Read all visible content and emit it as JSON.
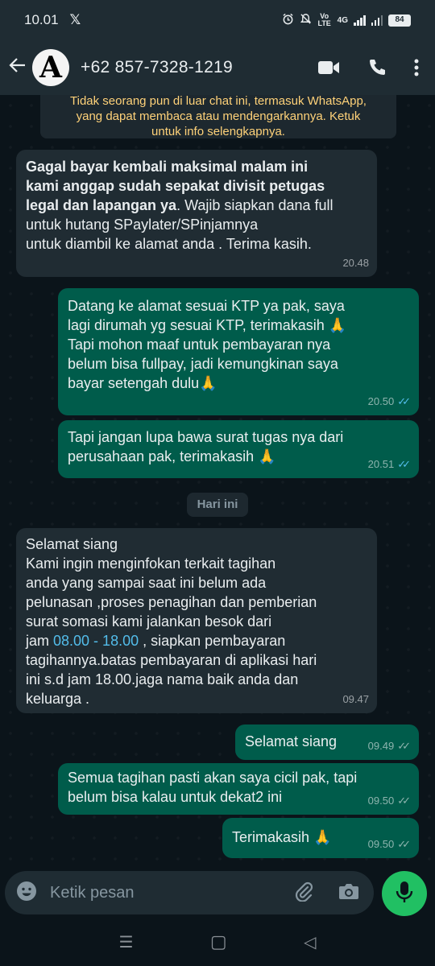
{
  "status_bar": {
    "time": "10.01",
    "x_logo": "𝕏",
    "network": "Vo LTE",
    "signal_label": "4G",
    "battery": "84"
  },
  "header": {
    "back_icon": "arrow-left-icon",
    "avatar_letter": "A",
    "contact": "+62 857-7328-1219",
    "icons": [
      "video-call-icon",
      "voice-call-icon",
      "more-vert-icon"
    ]
  },
  "encryption_notice": {
    "line1": "Tidak seorang pun di luar chat ini, termasuk WhatsApp,",
    "line2": "yang dapat membaca atau mendengarkannya. Ketuk",
    "line3": "untuk info selengkapnya."
  },
  "messages": [
    {
      "direction": "in",
      "bold_lines": [
        "Gagal bayar kembali maksimal malam ini",
        "kami anggap sudah sepakat divisit petugas",
        "legal dan lapangan ya"
      ],
      "rest_first": ". Wajib siapkan dana full",
      "lines": [
        "untuk hutang SPaylater/SPinjamnya",
        "untuk diambil ke alamat anda . Terima kasih."
      ],
      "time": "20.48"
    },
    {
      "direction": "out",
      "lines": [
        "Datang ke alamat sesuai KTP ya pak, saya",
        "lagi dirumah yg sesuai KTP, terimakasih 🙏",
        "Tapi mohon maaf untuk pembayaran nya",
        "belum bisa fullpay, jadi kemungkinan saya",
        "bayar setengah dulu🙏"
      ],
      "time": "20.50",
      "ticks": "✓✓"
    },
    {
      "direction": "out",
      "lines": [
        "Tapi jangan lupa bawa surat tugas nya dari",
        "perusahaan pak, terimakasih 🙏"
      ],
      "time": "20.51",
      "ticks": "✓✓"
    },
    {
      "direction": "in",
      "lines": [
        "Selamat siang",
        "Kami ingin menginfokan terkait tagihan",
        "anda yang sampai saat ini belum ada",
        "pelunasan ,proses penagihan dan pemberian",
        "surat somasi kami jalankan besok dari"
      ],
      "line6_prefix": "jam ",
      "line6_link": "08.00 - 18.00",
      "line6_suffix": " , siapkan pembayaran",
      "lines_after": [
        "tagihannya.batas pembayaran di aplikasi hari",
        "ini s.d jam 18.00.jaga nama baik anda dan",
        "keluarga ."
      ],
      "time": "09.47"
    },
    {
      "direction": "out",
      "lines": [
        "Selamat siang"
      ],
      "time": "09.49",
      "ticks": "✓✓"
    },
    {
      "direction": "out",
      "lines": [
        "Semua tagihan pasti akan saya cicil pak, tapi",
        "belum bisa kalau untuk dekat2 ini"
      ],
      "time": "09.50",
      "ticks": "✓✓"
    },
    {
      "direction": "out",
      "lines": [
        "Terimakasih 🙏"
      ],
      "time": "09.50",
      "ticks": "✓✓"
    }
  ],
  "date_divider": "Hari ini",
  "composer": {
    "placeholder": "Ketik pesan",
    "icons": [
      "emoji-icon",
      "attach-icon",
      "camera-icon",
      "mic-icon"
    ]
  },
  "nav": {
    "icons": [
      "recents-icon",
      "home-icon",
      "back-icon"
    ],
    "recents": "☰",
    "home": "▢",
    "back": "◁"
  },
  "colors": {
    "background": "#0b141a",
    "header": "#1f2c33",
    "incoming_bubble": "#202c33",
    "outgoing_bubble": "#005c4b",
    "read_ticks": "#53bdeb",
    "mic_button": "#21c063",
    "encryption_text": "#ffd279"
  }
}
